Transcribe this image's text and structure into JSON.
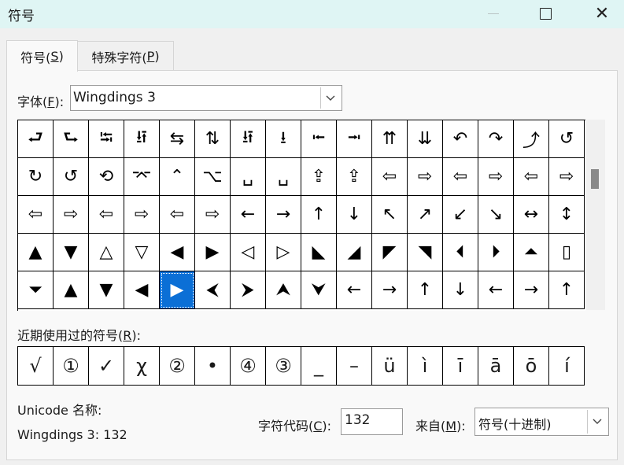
{
  "window": {
    "title": "符号",
    "minimize_icon": "minimize-icon",
    "maximize_icon": "maximize-icon",
    "close_glyph": "✕"
  },
  "tabs": {
    "symbols": {
      "label": "符号(",
      "key": "S",
      "suffix": ")"
    },
    "special": {
      "label": "特殊字符(",
      "key": "P",
      "suffix": ")"
    }
  },
  "font": {
    "label": "字体(",
    "key": "F",
    "suffix": "):",
    "value": "Wingdings 3"
  },
  "symbol_grid": {
    "rows": [
      [
        "⮐",
        "⮑",
        "⭾",
        "⭿",
        "⇆",
        "⇅",
        "⭿",
        "⭳",
        "⭰",
        "⭲",
        "⇈",
        "⇊",
        "↶",
        "↷",
        "⤴",
        "↺"
      ],
      [
        "↻",
        "↺",
        "⟲",
        "⌤",
        "⌃",
        "⌥",
        "␣",
        "␣",
        "⇪",
        "⇪",
        "⇦",
        "⇨",
        "⇦",
        "⇨",
        "⇦",
        "⇨"
      ],
      [
        "⇦",
        "⇨",
        "⇦",
        "⇨",
        "⇦",
        "⇨",
        "←",
        "→",
        "↑",
        "↓",
        "↖",
        "↗",
        "↙",
        "↘",
        "↔",
        "↕"
      ],
      [
        "▲",
        "▼",
        "△",
        "▽",
        "◀",
        "▶",
        "◁",
        "▷",
        "◣",
        "◢",
        "◤",
        "◥",
        "⏴",
        "⏵",
        "⏶",
        "▯"
      ],
      [
        "⏷",
        "▲",
        "▼",
        "◀",
        "▶",
        "⮜",
        "⮞",
        "⮝",
        "⮟",
        "←",
        "→",
        "↑",
        "↓",
        "←",
        "→",
        "↑"
      ]
    ],
    "selected": {
      "row": 4,
      "col": 4
    }
  },
  "recent": {
    "label": "近期使用过的符号(",
    "key": "R",
    "suffix": "):",
    "items": [
      "√",
      "①",
      "✓",
      "χ",
      "②",
      "•",
      "④",
      "③",
      "_",
      "–",
      "ü",
      "ì",
      "ī",
      "ā",
      "ō",
      "í"
    ]
  },
  "unicode": {
    "name_label": "Unicode 名称:",
    "name_value": "Wingdings 3: 132"
  },
  "char_code": {
    "label": "字符代码(",
    "key": "C",
    "suffix": "):",
    "value": "132"
  },
  "from": {
    "label": "来自(",
    "key": "M",
    "suffix": "):",
    "value": "符号(十进制)"
  },
  "icons": {
    "dropdown": "chevron-down-icon"
  }
}
